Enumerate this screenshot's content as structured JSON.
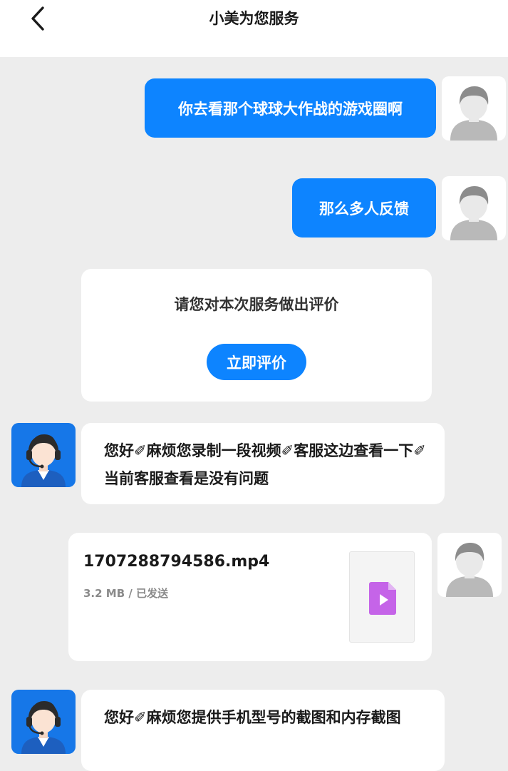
{
  "header": {
    "title": "小美为您服务",
    "back_icon": "chevron-left-icon"
  },
  "colors": {
    "accent": "#0d84ff",
    "background": "#ededed",
    "agent_avatar": "#1677e8",
    "file_icon": "#c564e8"
  },
  "messages": [
    {
      "type": "outgoing",
      "text": "你去看那个球球大作战的游戏圈啊"
    },
    {
      "type": "outgoing",
      "text": "那么多人反馈"
    },
    {
      "type": "rating",
      "prompt": "请您对本次服务做出评价",
      "button": "立即评价"
    },
    {
      "type": "incoming",
      "text": "您好✐麻烦您录制一段视频✐客服这边查看一下✐当前客服查看是没有问题"
    },
    {
      "type": "file",
      "name": "1707288794586.mp4",
      "meta": "3.2 MB / 已发送",
      "icon": "video-file-icon"
    },
    {
      "type": "incoming",
      "text": "您好✐麻烦您提供手机型号的截图和内存截图"
    }
  ]
}
